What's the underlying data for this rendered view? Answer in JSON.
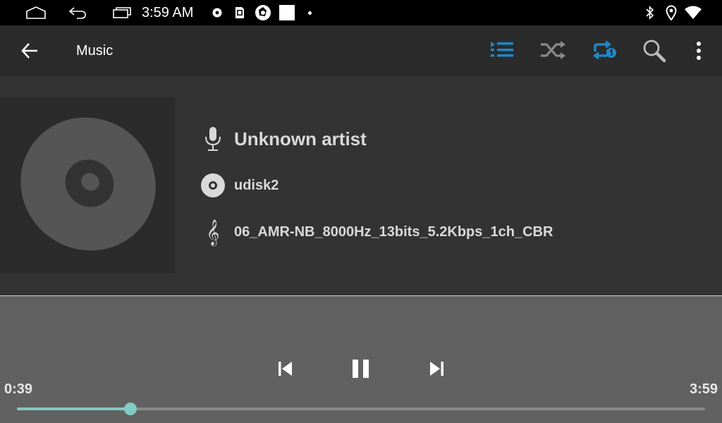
{
  "status_bar": {
    "time": "3:59 AM",
    "icons": [
      "home-outline-icon",
      "back-arrow-icon",
      "recents-icon",
      "disc-icon",
      "sd-card-icon",
      "shutter-icon",
      "white-square-icon",
      "dot-icon",
      "bluetooth-icon",
      "location-icon",
      "wifi-icon"
    ]
  },
  "toolbar": {
    "title": "Music",
    "icons": [
      "back-arrow-icon",
      "playlist-icon",
      "shuffle-icon",
      "repeat-one-icon",
      "search-icon",
      "more-vert-icon"
    ],
    "accent": "#1e88c8"
  },
  "track_info": {
    "artist": "Unknown artist",
    "album": "udisk2",
    "title": "06_AMR-NB_8000Hz_13bits_5.2Kbps_1ch_CBR"
  },
  "player": {
    "elapsed": "0:39",
    "duration": "3:59",
    "progress": 0.165,
    "progress_color": "#80cbc4"
  }
}
